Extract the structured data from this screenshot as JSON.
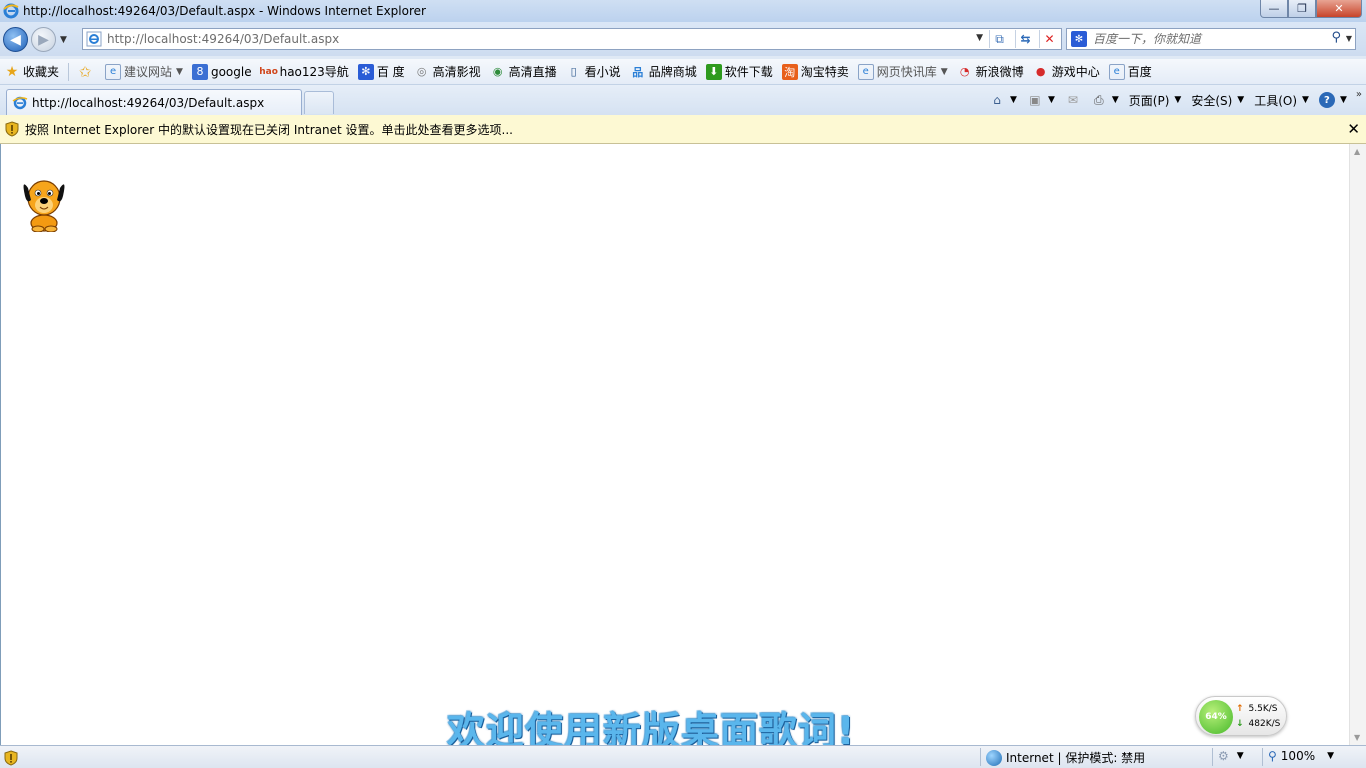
{
  "window": {
    "title": "http://localhost:49264/03/Default.aspx - Windows Internet Explorer",
    "minimize_glyph": "—",
    "restore_glyph": "❐",
    "close_glyph": "✕"
  },
  "address_bar": {
    "url": "http://localhost:49264/03/Default.aspx"
  },
  "search": {
    "placeholder": "百度一下，你就知道"
  },
  "favorites": {
    "favorites_label": "收藏夹",
    "items": [
      {
        "label": "建议网站",
        "icon": "ie-page-icon",
        "dropdown": true,
        "grey": true
      },
      {
        "label": "google",
        "icon": "google-icon"
      },
      {
        "label": "hao123导航",
        "icon": "hao123-icon"
      },
      {
        "label": "百 度",
        "icon": "baidu-paw-icon"
      },
      {
        "label": "高清影视",
        "icon": "film-icon"
      },
      {
        "label": "高清直播",
        "icon": "tv-icon"
      },
      {
        "label": "看小说",
        "icon": "book-icon"
      },
      {
        "label": "品牌商城",
        "icon": "shop-icon"
      },
      {
        "label": "软件下载",
        "icon": "download-icon"
      },
      {
        "label": "淘宝特卖",
        "icon": "taobao-icon"
      },
      {
        "label": "网页快讯库",
        "icon": "ie-page-icon",
        "dropdown": true,
        "grey": true
      },
      {
        "label": "新浪微博",
        "icon": "weibo-icon"
      },
      {
        "label": "游戏中心",
        "icon": "game-pin-icon"
      },
      {
        "label": "百度",
        "icon": "ie-page-icon"
      }
    ]
  },
  "tabs": [
    {
      "label": "http://localhost:49264/03/Default.aspx"
    }
  ],
  "command_bar": {
    "page_label": "页面(P)",
    "safety_label": "安全(S)",
    "tools_label": "工具(O)"
  },
  "info_bar": {
    "message": "按照 Internet Explorer 中的默认设置现在已关闭 Intranet 设置。单击此处查看更多选项..."
  },
  "desktop_lyrics": {
    "text": "欢迎使用新版桌面歌词!"
  },
  "net_widget": {
    "percent": "64%",
    "upload": "5.5K/S",
    "download": "482K/S"
  },
  "status_bar": {
    "zone": "Internet | 保护模式: 禁用",
    "zoom": "100%"
  },
  "colors": {
    "lyrics": "#5ab6ec",
    "info_bar_bg": "#fdf9d3",
    "accent": "#1d5fb8"
  }
}
